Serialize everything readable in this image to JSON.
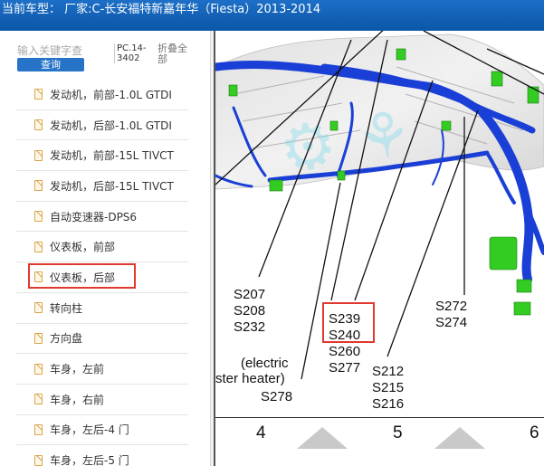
{
  "header": {
    "title": "当前车型：  厂家:C-长安福特新嘉年华（Fiesta）2013-2014"
  },
  "search": {
    "placeholder": "输入关键字查",
    "button_label": "查询"
  },
  "pc_code": "PC.14-3402",
  "collapse_label": "折叠全部",
  "tree_items": [
    {
      "label": "发动机，前部-1.0L GTDI",
      "selected": false
    },
    {
      "label": "发动机，后部-1.0L GTDI",
      "selected": false
    },
    {
      "label": "发动机，前部-15L TIVCT",
      "selected": false
    },
    {
      "label": "发动机，后部-15L TIVCT",
      "selected": false
    },
    {
      "label": "自动变速器-DPS6",
      "selected": false
    },
    {
      "label": "仪表板，前部",
      "selected": false
    },
    {
      "label": "仪表板，后部",
      "selected": true
    },
    {
      "label": "转向柱",
      "selected": false
    },
    {
      "label": "方向盘",
      "selected": false
    },
    {
      "label": "车身，左前",
      "selected": false
    },
    {
      "label": "车身，右前",
      "selected": false
    },
    {
      "label": "车身，左后-4 门",
      "selected": false
    },
    {
      "label": "车身，左后-5 门",
      "selected": false
    }
  ],
  "diagram": {
    "callouts": {
      "group_a": [
        "S207",
        "S208",
        "S232"
      ],
      "group_b": [
        "S239",
        "S240",
        "S260",
        "S277"
      ],
      "group_c": [
        "S212",
        "S215",
        "S216"
      ],
      "group_d": [
        "S272",
        "S274"
      ],
      "note_line1": "(electric",
      "note_line2": "ster heater)",
      "note_code": "S278"
    },
    "zones": [
      "4",
      "5",
      "6"
    ],
    "colors": {
      "harness": "#1a3fd6",
      "connector": "#33cc22",
      "highlight": "#e0392f"
    }
  },
  "colors": {
    "titlebar": "#0f5fb8",
    "accent_button": "#2673c8",
    "selection": "#e0392f"
  }
}
